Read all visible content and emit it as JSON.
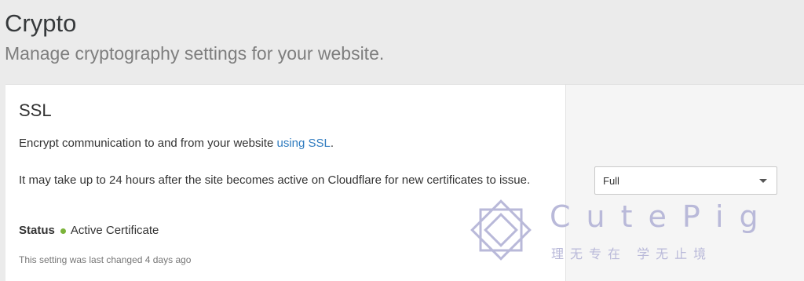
{
  "header": {
    "title": "Crypto",
    "subtitle": "Manage cryptography settings for your website."
  },
  "ssl_card": {
    "title": "SSL",
    "description_prefix": "Encrypt communication to and from your website ",
    "description_link": "using SSL",
    "description_suffix": ".",
    "note": "It may take up to 24 hours after the site becomes active on Cloudflare for new certificates to issue.",
    "status_label": "Status",
    "status_value": "Active Certificate",
    "last_changed": "This setting was last changed 4 days ago",
    "mode_select": {
      "selected": "Full",
      "icon": "chevron-down-icon"
    }
  },
  "watermark": {
    "name": "CutePig",
    "slogan": "理无专在 学无止境",
    "color": "#b9b9d9"
  },
  "colors": {
    "link": "#2f7bbf",
    "status_active": "#7bb33a",
    "background": "#ebebeb"
  }
}
